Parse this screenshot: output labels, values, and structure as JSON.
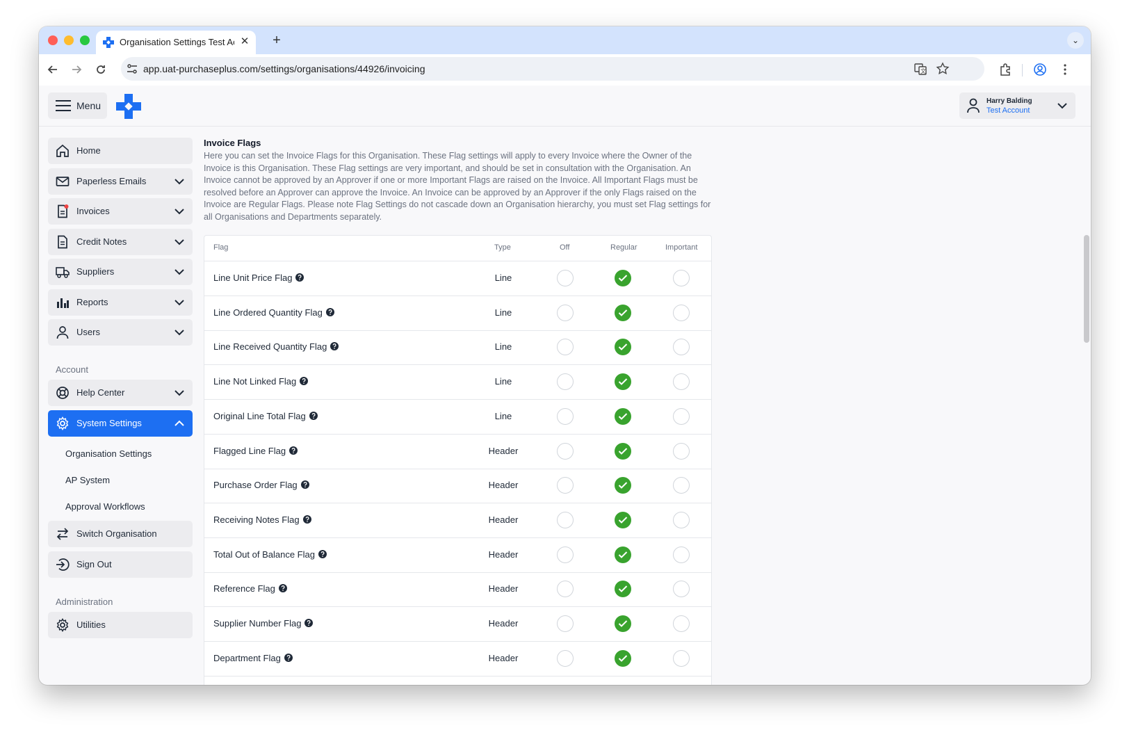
{
  "browser": {
    "tab_title": "Organisation Settings Test Ac",
    "close_symbol": "✕",
    "new_tab_symbol": "+",
    "url": "app.uat-purchaseplus.com/settings/organisations/44926/invoicing"
  },
  "header": {
    "menu_label": "Menu",
    "user_name": "Harry Balding",
    "user_account": "Test Account"
  },
  "sidebar": {
    "items": [
      {
        "label": "Home",
        "icon": "home-icon"
      },
      {
        "label": "Paperless Emails",
        "icon": "mail-icon"
      },
      {
        "label": "Invoices",
        "icon": "invoice-icon"
      },
      {
        "label": "Credit Notes",
        "icon": "document-icon"
      },
      {
        "label": "Suppliers",
        "icon": "truck-icon"
      },
      {
        "label": "Reports",
        "icon": "chart-icon"
      },
      {
        "label": "Users",
        "icon": "user-icon"
      }
    ],
    "account_section": "Account",
    "account_items": [
      {
        "label": "Help Center",
        "icon": "lifebuoy-icon"
      },
      {
        "label": "System Settings",
        "icon": "gear-icon"
      }
    ],
    "settings_subitems": [
      "Organisation Settings",
      "AP System",
      "Approval Workflows"
    ],
    "switch_org": "Switch Organisation",
    "sign_out": "Sign Out",
    "admin_section": "Administration",
    "utilities": "Utilities"
  },
  "main": {
    "title": "Invoice Flags",
    "description": "Here you can set the Invoice Flags for this Organisation. These Flag settings will apply to every Invoice where the Owner of the Invoice is this Organisation. These Flag settings are very important, and should be set in consultation with the Organisation. An Invoice cannot be approved by an Approver if one or more Important Flags are raised on the Invoice. All Important Flags must be resolved before an Approver can approve the Invoice. An Invoice can be approved by an Approver if the only Flags raised on the Invoice are Regular Flags. Please note Flag Settings do not cascade down an Organisation hierarchy, you must set Flag settings for all Organisations and Departments separately.",
    "columns": [
      "Flag",
      "Type",
      "Off",
      "Regular",
      "Important"
    ],
    "rows": [
      {
        "flag": "Line Unit Price Flag",
        "type": "Line",
        "level": "Regular"
      },
      {
        "flag": "Line Ordered Quantity Flag",
        "type": "Line",
        "level": "Regular"
      },
      {
        "flag": "Line Received Quantity Flag",
        "type": "Line",
        "level": "Regular"
      },
      {
        "flag": "Line Not Linked Flag",
        "type": "Line",
        "level": "Regular"
      },
      {
        "flag": "Original Line Total Flag",
        "type": "Line",
        "level": "Regular"
      },
      {
        "flag": "Flagged Line Flag",
        "type": "Header",
        "level": "Regular"
      },
      {
        "flag": "Purchase Order Flag",
        "type": "Header",
        "level": "Regular"
      },
      {
        "flag": "Receiving Notes Flag",
        "type": "Header",
        "level": "Regular"
      },
      {
        "flag": "Total Out of Balance Flag",
        "type": "Header",
        "level": "Regular"
      },
      {
        "flag": "Reference Flag",
        "type": "Header",
        "level": "Regular"
      },
      {
        "flag": "Supplier Number Flag",
        "type": "Header",
        "level": "Regular"
      },
      {
        "flag": "Department Flag",
        "type": "Header",
        "level": "Regular"
      }
    ]
  },
  "colors": {
    "accent": "#1d6ff2",
    "selected_radio": "#39a32e",
    "notification_dot": "#ef4444"
  }
}
